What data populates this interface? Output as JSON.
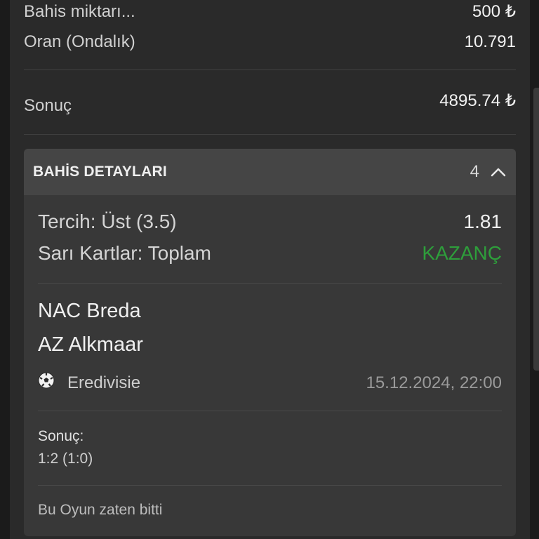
{
  "summary": {
    "stake_label": "Bahis miktarı...",
    "stake_value": "500 ₺",
    "odds_label": "Oran (Ondalık)",
    "odds_value": "10.791",
    "result_label": "Sonuç",
    "result_value": "4895.74 ₺"
  },
  "details": {
    "title": "BAHİS DETAYLARI",
    "count": "4",
    "selection_label": "Tercih: Üst (3.5)",
    "selection_odds": "1.81",
    "market": "Sarı Kartlar: Toplam",
    "market_status": "KAZANÇ",
    "home_team": "NAC Breda",
    "away_team": "AZ Alkmaar",
    "league": "Eredivisie",
    "datetime": "15.12.2024, 22:00",
    "score_label": "Sonuç:",
    "score_value": "1:2 (1:0)",
    "game_status": "Bu Oyun zaten bitti"
  },
  "colors": {
    "win": "#2e9e3b",
    "panel": "#2a2a2a",
    "card": "#383838"
  },
  "icons": {
    "collapse": "chevron-up-icon",
    "sport": "soccer-ball-icon"
  }
}
